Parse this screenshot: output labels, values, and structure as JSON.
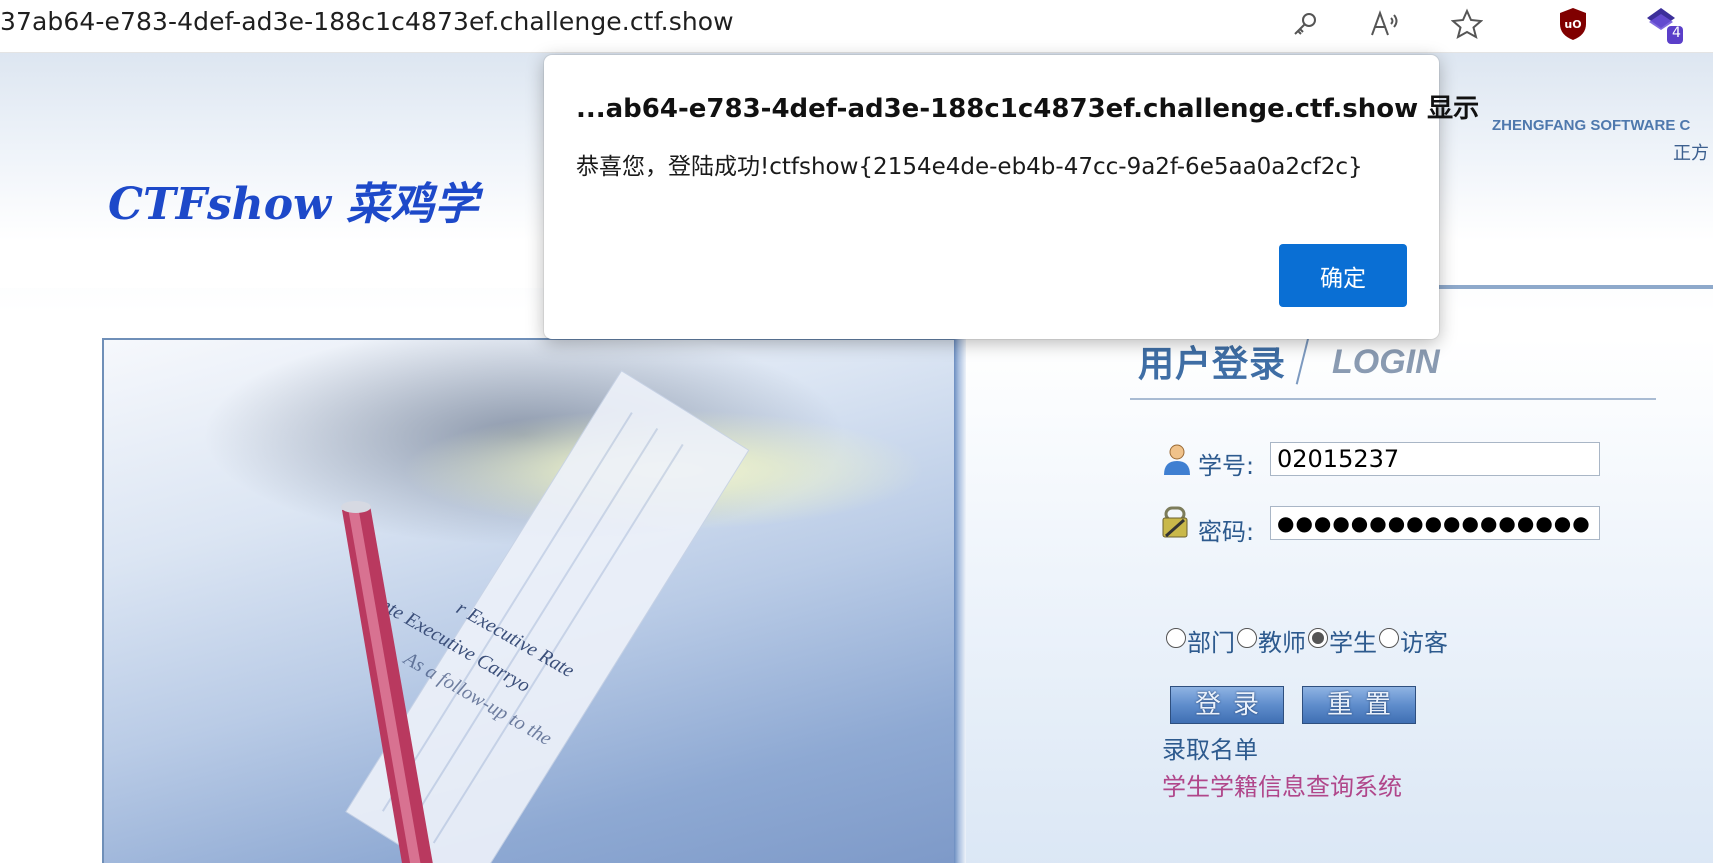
{
  "browser": {
    "url": "37ab64-e783-4def-ad3e-188c1c4873ef.challenge.ctf.show",
    "toolbar_icons": [
      "key-icon",
      "read-aloud-icon",
      "favorite-star-icon",
      "ublock-icon",
      "extension-icon"
    ],
    "extension_badge": "4",
    "accent_color": "#0a6fd4"
  },
  "dialog": {
    "title": "...ab64-e783-4def-ad3e-188c1c4873ef.challenge.ctf.show 显示",
    "message": "恭喜您，登陆成功!ctfshow{2154e4de-eb4b-47cc-9a2f-6e5aa0a2cf2c}",
    "ok_label": "确定"
  },
  "header": {
    "logo_text": "CTFshow 菜鸡学",
    "company_en": "ZHENGFANG SOFTWARE C",
    "company_cn": "正方"
  },
  "photo": {
    "lines": [
      "r Executive Rate",
      "Inte  Executive Carryo",
      "As a follow-up to the"
    ]
  },
  "login": {
    "title": "用户登录",
    "subtitle": "LOGIN",
    "student_id_label": "学号:",
    "student_id_value": "02015237",
    "password_label": "密码:",
    "password_value": "●●●●●●●●●●●●●●●●●",
    "roles": [
      {
        "label": "部门",
        "checked": false
      },
      {
        "label": "教师",
        "checked": false
      },
      {
        "label": "学生",
        "checked": true
      },
      {
        "label": "访客",
        "checked": false
      }
    ],
    "login_button": "登录",
    "reset_button": "重置",
    "admission_link": "录取名单",
    "status_link": "学生学籍信息查询系统"
  }
}
